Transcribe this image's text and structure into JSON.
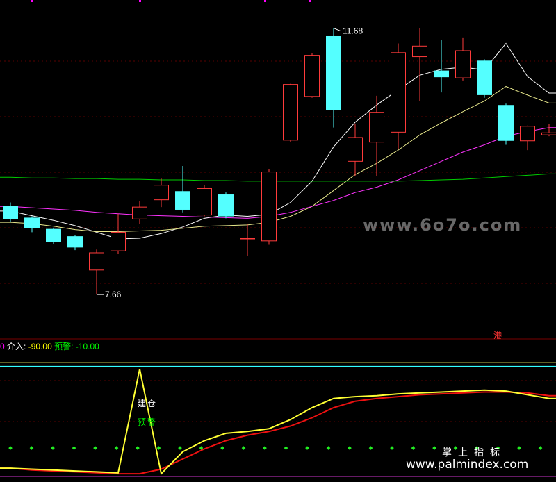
{
  "chart_data": [
    {
      "type": "candlestick",
      "price_labels": {
        "high": "11.68",
        "low": "7.66"
      },
      "high_value": 11.68,
      "low_value": 7.66,
      "ylim": [
        7.2,
        12.0
      ],
      "candles": [
        {
          "o": 9.0,
          "c": 8.8,
          "h": 9.05,
          "l": 8.76
        },
        {
          "o": 8.82,
          "c": 8.66,
          "h": 8.84,
          "l": 8.6
        },
        {
          "o": 8.65,
          "c": 8.45,
          "h": 8.67,
          "l": 8.42
        },
        {
          "o": 8.54,
          "c": 8.37,
          "h": 8.56,
          "l": 8.33
        },
        {
          "o": 8.03,
          "c": 8.29,
          "h": 8.34,
          "l": 7.66
        },
        {
          "o": 8.32,
          "c": 8.6,
          "h": 8.88,
          "l": 8.28
        },
        {
          "o": 8.8,
          "c": 8.98,
          "h": 9.07,
          "l": 8.72
        },
        {
          "o": 9.09,
          "c": 9.31,
          "h": 9.41,
          "l": 8.98
        },
        {
          "o": 9.22,
          "c": 8.94,
          "h": 9.6,
          "l": 8.9
        },
        {
          "o": 8.86,
          "c": 9.26,
          "h": 9.31,
          "l": 8.84
        },
        {
          "o": 9.17,
          "c": 8.84,
          "h": 9.2,
          "l": 8.81
        },
        {
          "o": 8.5,
          "c": 8.51,
          "h": 8.73,
          "l": 8.24
        },
        {
          "o": 8.47,
          "c": 9.51,
          "h": 9.55,
          "l": 8.41
        },
        {
          "o": 9.99,
          "c": 10.83,
          "h": 10.84,
          "l": 9.96
        },
        {
          "o": 10.65,
          "c": 11.27,
          "h": 11.3,
          "l": 10.63
        },
        {
          "o": 11.56,
          "c": 10.44,
          "h": 11.68,
          "l": 10.18
        },
        {
          "o": 9.67,
          "c": 10.03,
          "h": 10.24,
          "l": 9.45
        },
        {
          "o": 9.96,
          "c": 10.41,
          "h": 10.66,
          "l": 9.45
        },
        {
          "o": 10.11,
          "c": 11.31,
          "h": 11.45,
          "l": 9.86
        },
        {
          "o": 11.25,
          "c": 11.41,
          "h": 11.68,
          "l": 10.58
        },
        {
          "o": 11.04,
          "c": 10.94,
          "h": 11.5,
          "l": 10.71
        },
        {
          "o": 10.93,
          "c": 11.34,
          "h": 11.54,
          "l": 10.89
        },
        {
          "o": 11.19,
          "c": 10.67,
          "h": 11.21,
          "l": 10.63
        },
        {
          "o": 10.52,
          "c": 9.98,
          "h": 10.54,
          "l": 9.92
        },
        {
          "o": 9.98,
          "c": 10.2,
          "h": 10.21,
          "l": 9.84
        },
        {
          "o": 10.07,
          "c": 10.1,
          "h": 10.23,
          "l": 10.05
        }
      ],
      "ma_series": [
        {
          "color": "#ffffff",
          "values": [
            8.92,
            8.85,
            8.78,
            8.7,
            8.6,
            8.5,
            8.51,
            8.58,
            8.68,
            8.81,
            8.86,
            8.84,
            8.87,
            9.05,
            9.37,
            9.89,
            10.26,
            10.52,
            10.75,
            10.97,
            11.06,
            11.09,
            11.05,
            11.45,
            10.95,
            10.7
          ]
        },
        {
          "color": "#e8e88c",
          "values": [
            8.75,
            8.73,
            8.69,
            8.64,
            8.61,
            8.61,
            8.62,
            8.63,
            8.66,
            8.69,
            8.7,
            8.71,
            8.75,
            8.84,
            8.99,
            9.23,
            9.47,
            9.64,
            9.84,
            10.07,
            10.25,
            10.42,
            10.58,
            10.8,
            10.67,
            10.55
          ]
        },
        {
          "color": "#ff33ff",
          "values": [
            8.99,
            8.97,
            8.95,
            8.93,
            8.9,
            8.88,
            8.86,
            8.85,
            8.84,
            8.83,
            8.82,
            8.81,
            8.84,
            8.9,
            8.99,
            9.08,
            9.2,
            9.28,
            9.39,
            9.53,
            9.67,
            9.81,
            9.92,
            10.05,
            10.12,
            10.18
          ]
        },
        {
          "color": "#00cc00",
          "values": [
            9.43,
            9.42,
            9.42,
            9.41,
            9.41,
            9.4,
            9.4,
            9.39,
            9.39,
            9.38,
            9.38,
            9.37,
            9.37,
            9.37,
            9.37,
            9.37,
            9.37,
            9.37,
            9.37,
            9.38,
            9.39,
            9.4,
            9.42,
            9.44,
            9.46,
            9.48
          ]
        }
      ]
    },
    {
      "type": "line",
      "legend": {
        "zero": "0",
        "entry_label": "介入:",
        "entry_value": "-90.00",
        "warn_label": "预警:",
        "warn_value": "-10.00"
      },
      "ylim": [
        -100,
        40
      ],
      "ref_lines": [
        {
          "value": 27,
          "color": "#ffff66"
        },
        {
          "value": 23,
          "color": "#33ffff"
        }
      ],
      "yellow_line": [
        -88,
        -89,
        -90,
        -91,
        -92,
        -93,
        20,
        -94,
        -70,
        -58,
        -50,
        -48,
        -45,
        -35,
        -22,
        -12,
        -10,
        -9,
        -7,
        -6,
        -5,
        -4,
        -3,
        -4,
        -8,
        -12
      ],
      "red_line": [
        -88,
        -90,
        -91,
        -92,
        -93,
        -94,
        -94,
        -89,
        -78,
        -67,
        -58,
        -52,
        -48,
        -42,
        -33,
        -22,
        -15,
        -12,
        -10,
        -8,
        -7,
        -6,
        -5,
        -5,
        -6,
        -9
      ],
      "dot_level": -66,
      "signals": {
        "buy": "建仓",
        "warn": "预警"
      }
    }
  ],
  "badge": {
    "hk": "港"
  },
  "watermarks": {
    "top": "www.6o7o.com",
    "brand_cn": "掌上指标",
    "brand_url": "www.palmindex.com"
  }
}
